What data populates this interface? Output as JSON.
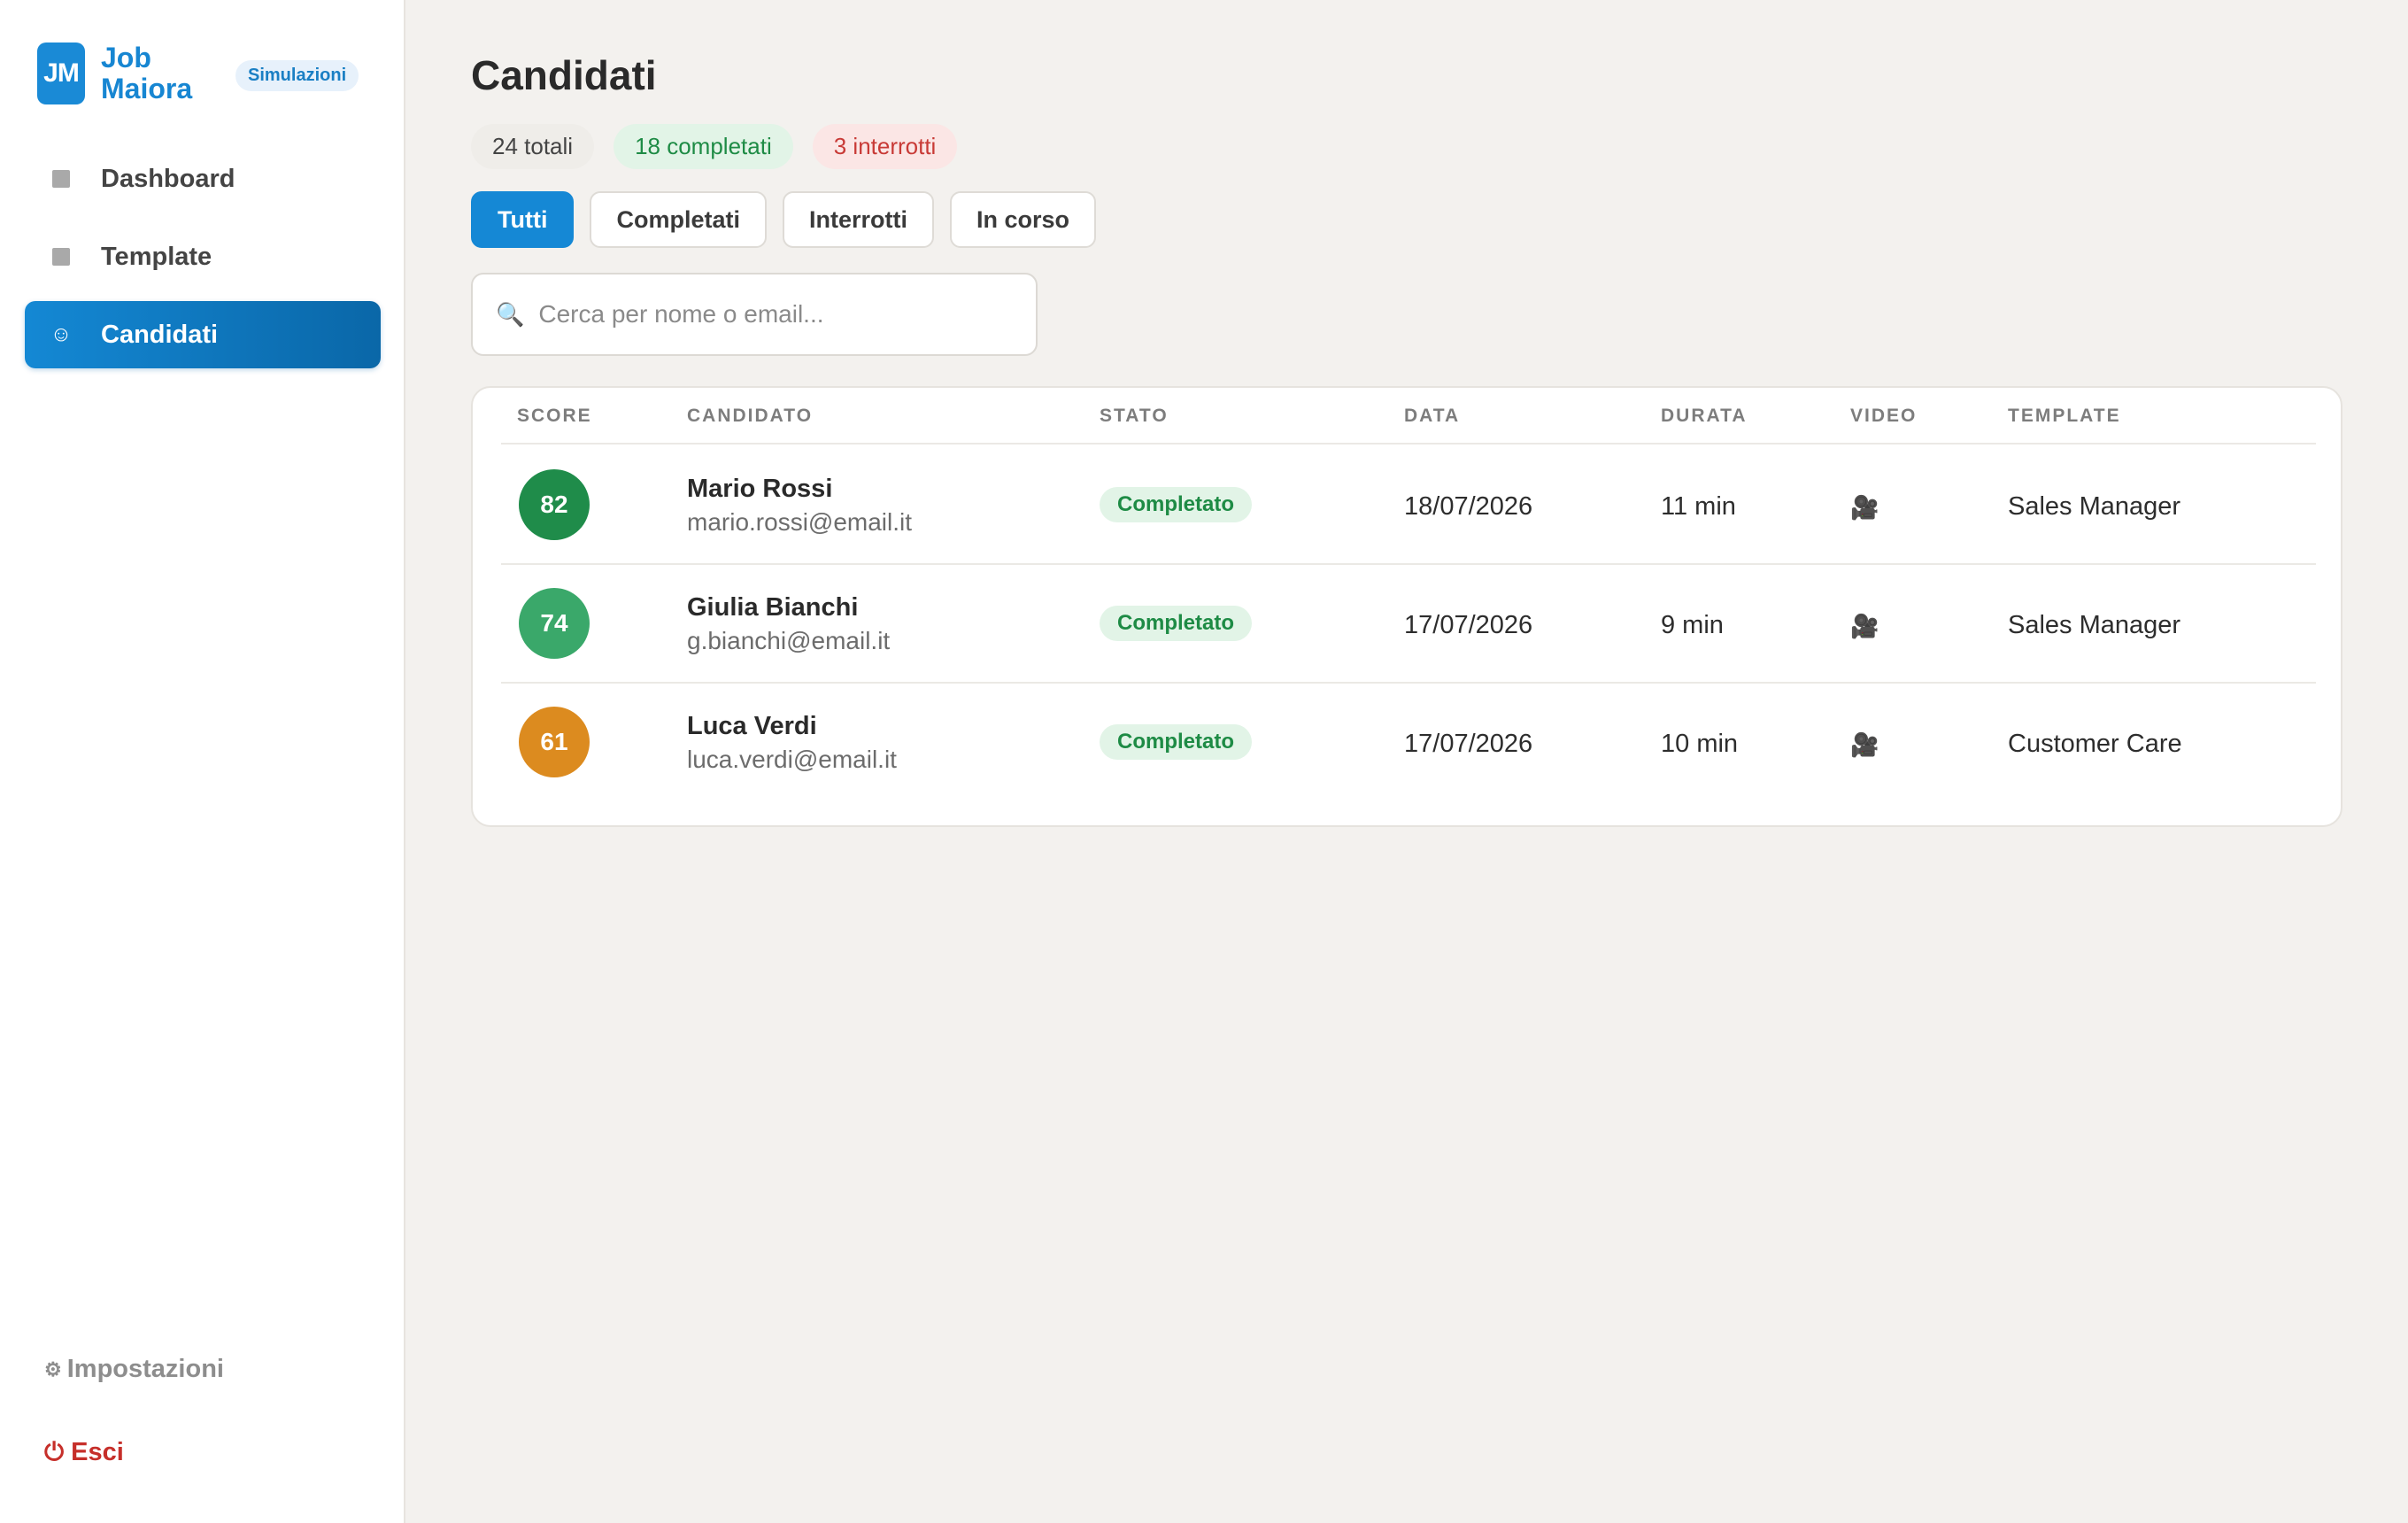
{
  "brand": {
    "logo": "JM",
    "name_line1": "Job",
    "name_line2": "Maiora",
    "badge": "Simulazioni"
  },
  "sidebar": {
    "items": [
      {
        "label": "Dashboard",
        "icon": "square-icon"
      },
      {
        "label": "Template",
        "icon": "square-icon"
      },
      {
        "label": "Candidati",
        "icon": "smile-icon",
        "active": true
      }
    ],
    "settings_label": "Impostazioni",
    "logout_label": "Esci"
  },
  "main": {
    "title": "Candidati",
    "stats": {
      "total": "24 totali",
      "completed": "18 completati",
      "interrupted": "3 interrotti"
    },
    "filters": [
      "Tutti",
      "Completati",
      "Interrotti",
      "In corso"
    ],
    "search_placeholder": "Cerca per nome o email...",
    "table": {
      "headers": [
        "SCORE",
        "CANDIDATO",
        "STATO",
        "DATA",
        "DURATA",
        "VIDEO",
        "TEMPLATE"
      ],
      "rows": [
        {
          "score": "82",
          "score_color": "#1f8c4a",
          "name": "Mario Rossi",
          "email": "mario.rossi@email.it",
          "status": "Completato",
          "date": "18/07/2026",
          "duration": "11 min",
          "template": "Sales Manager"
        },
        {
          "score": "74",
          "score_color": "#3aa86a",
          "name": "Giulia Bianchi",
          "email": "g.bianchi@email.it",
          "status": "Completato",
          "date": "17/07/2026",
          "duration": "9 min",
          "template": "Sales Manager"
        },
        {
          "score": "61",
          "score_color": "#dc8b1f",
          "name": "Luca Verdi",
          "email": "luca.verdi@email.it",
          "status": "Completato",
          "date": "17/07/2026",
          "duration": "10 min",
          "template": "Customer Care"
        }
      ]
    }
  },
  "colors": {
    "accent": "#1588d5",
    "success": "#1e8b45",
    "danger": "#c62f2a"
  }
}
